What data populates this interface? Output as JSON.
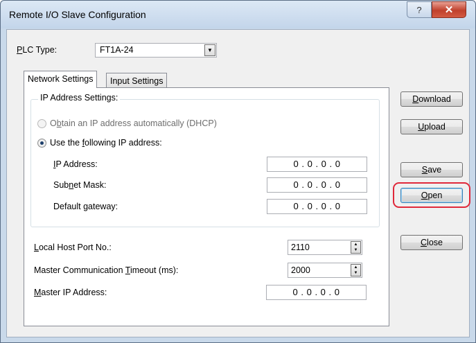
{
  "window": {
    "title": "Remote I/O Slave Configuration",
    "help_glyph": "?",
    "close_glyph": "✕"
  },
  "plc_type": {
    "label_first": "P",
    "label_rest": "LC Type:",
    "value": "FT1A-24"
  },
  "tabs": [
    {
      "label": "Network Settings",
      "active": true
    },
    {
      "label": "Input Settings",
      "active": false
    }
  ],
  "ip_settings": {
    "group_title": "IP Address Settings:",
    "dhcp": {
      "pre": "O",
      "key": "b",
      "post": "tain an IP address automatically (DHCP)",
      "checked": false,
      "enabled": false
    },
    "manual": {
      "pre": "Use the ",
      "key": "f",
      "post": "ollowing IP address:",
      "checked": true
    },
    "fields": [
      {
        "pre": "",
        "key": "I",
        "post": "P Address:",
        "value": "0 . 0 . 0 . 0"
      },
      {
        "pre": "Sub",
        "key": "n",
        "post": "et Mask:",
        "value": "0 . 0 . 0 . 0"
      },
      {
        "pre": "Default ",
        "key": "g",
        "post": "ateway:",
        "value": "0 . 0 . 0 . 0"
      }
    ]
  },
  "local_port": {
    "key": "L",
    "post": "ocal Host Port No.:",
    "value": "2110"
  },
  "timeout": {
    "pre": "Master Communication ",
    "key": "T",
    "post": "imeout (ms):",
    "value": "2000"
  },
  "master_ip": {
    "key": "M",
    "post": "aster IP Address:",
    "value": "0 . 0 . 0 . 0"
  },
  "buttons": [
    {
      "key": "D",
      "post": "ownload"
    },
    {
      "key": "U",
      "post": "pload"
    },
    {
      "key": "S",
      "post": "ave"
    },
    {
      "key": "O",
      "post": "pen"
    },
    {
      "key": "C",
      "post": "lose"
    }
  ],
  "highlight_color": "#e0283a"
}
